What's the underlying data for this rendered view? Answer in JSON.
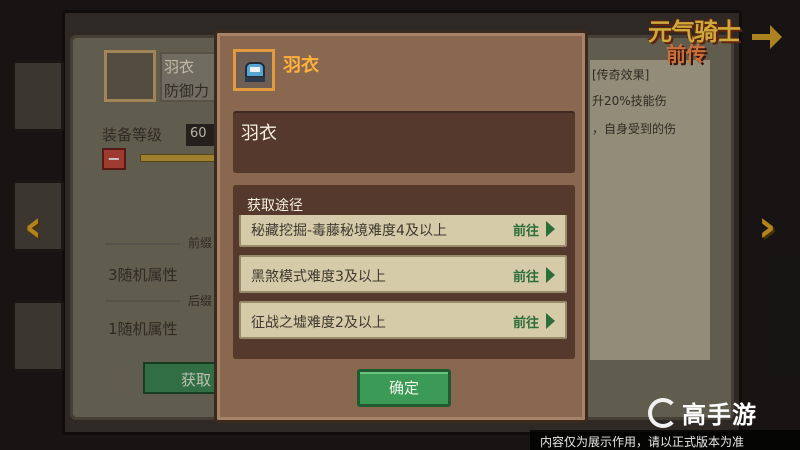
{
  "logo": {
    "main": "元气骑士",
    "sub": "前传"
  },
  "background": {
    "item_name": "羽衣",
    "item_stat": "防御力",
    "level_label": "装备等级",
    "level_value": "60",
    "section_front": "前缀",
    "section_back": "后缀",
    "attr_front": "3随机属性",
    "attr_back": "1随机属性",
    "green_button": "获取",
    "right_header": "[传奇效果]",
    "right_line1": "升20%技能伤",
    "right_line2": "，自身受到的伤"
  },
  "modal": {
    "title": "羽衣",
    "description": "羽衣",
    "sources_title": "获取途径",
    "sources": [
      {
        "text": "秘藏挖掘-毒藤秘境难度4及以上",
        "action": "前往"
      },
      {
        "text": "黑煞模式难度3及以上",
        "action": "前往"
      },
      {
        "text": "征战之墟难度2及以上",
        "action": "前往"
      }
    ],
    "confirm_label": "确定"
  },
  "watermark": {
    "brand": "高手游",
    "notice": "内容仅为展示作用，请以正式版本为准"
  },
  "colors": {
    "title_orange": "#ffb13d",
    "confirm_green": "#3c9a57",
    "go_green": "#2c6d3a"
  }
}
